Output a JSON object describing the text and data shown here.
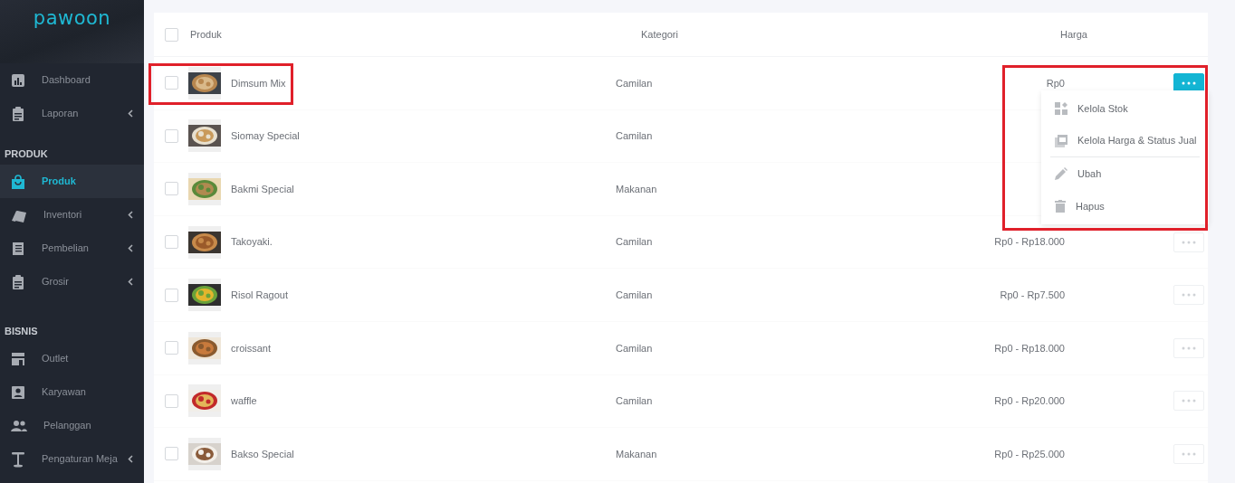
{
  "sidebar": {
    "logo": "pawoon",
    "items": [
      {
        "kind": "item",
        "label": "Dashboard",
        "selected": false,
        "has_submenu": false
      },
      {
        "kind": "item",
        "label": "Laporan",
        "selected": false,
        "has_submenu": true
      },
      {
        "kind": "section",
        "label": "PRODUK"
      },
      {
        "kind": "item",
        "label": "Produk",
        "selected": true,
        "has_submenu": false
      },
      {
        "kind": "item",
        "label": "Inventori",
        "selected": false,
        "has_submenu": true
      },
      {
        "kind": "item",
        "label": "Pembelian",
        "selected": false,
        "has_submenu": true
      },
      {
        "kind": "item",
        "label": "Grosir",
        "selected": false,
        "has_submenu": true
      },
      {
        "kind": "section",
        "label": "BISNIS"
      },
      {
        "kind": "item",
        "label": "Outlet",
        "selected": false,
        "has_submenu": false
      },
      {
        "kind": "item",
        "label": "Karyawan",
        "selected": false,
        "has_submenu": false
      },
      {
        "kind": "item",
        "label": "Pelanggan",
        "selected": false,
        "has_submenu": false
      },
      {
        "kind": "item",
        "label": "Pengaturan Meja",
        "selected": false,
        "has_submenu": true
      }
    ]
  },
  "table": {
    "select_all_checked": false,
    "columns": [
      "Produk",
      "Kategori",
      "Harga"
    ],
    "rows": [
      {
        "name": "Dimsum Mix",
        "category": "Camilan",
        "price": "Rp0",
        "checked": false,
        "highlighted": true,
        "menu_open": true
      },
      {
        "name": "Siomay Special",
        "category": "Camilan",
        "checked": false,
        "highlighted": false,
        "menu_open": false
      },
      {
        "name": "Bakmi Special",
        "category": "Makanan",
        "checked": false,
        "highlighted": false,
        "menu_open": false
      },
      {
        "name": "Takoyaki.",
        "category": "Camilan",
        "price": "Rp0 - Rp18.000",
        "checked": false,
        "highlighted": false,
        "menu_open": false
      },
      {
        "name": "Risol Ragout",
        "category": "Camilan",
        "price": "Rp0 - Rp7.500",
        "checked": false,
        "highlighted": false,
        "menu_open": false
      },
      {
        "name": "croissant",
        "category": "Camilan",
        "price": "Rp0 - Rp18.000",
        "checked": false,
        "highlighted": false,
        "menu_open": false
      },
      {
        "name": "waffle",
        "category": "Camilan",
        "price": "Rp0 - Rp20.000",
        "checked": false,
        "highlighted": false,
        "menu_open": false
      },
      {
        "name": "Bakso Special",
        "category": "Makanan",
        "price": "Rp0 - Rp25.000",
        "checked": false,
        "highlighted": false,
        "menu_open": false
      }
    ]
  },
  "action_menu": {
    "highlighted": true,
    "items": [
      {
        "label": "Kelola Stok",
        "divider_after": false
      },
      {
        "label": "Kelola Harga & Status Jual",
        "divider_after": true
      },
      {
        "label": "Ubah",
        "divider_after": false
      },
      {
        "label": "Hapus",
        "divider_after": false
      }
    ]
  }
}
